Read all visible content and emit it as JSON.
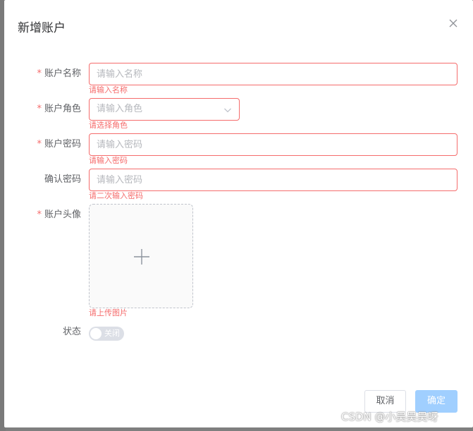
{
  "dialog": {
    "title": "新增账户"
  },
  "form": {
    "name": {
      "required": "*",
      "label": "账户名称",
      "placeholder": "请输入名称",
      "error": "请输入名称"
    },
    "role": {
      "required": "*",
      "label": "账户角色",
      "placeholder": "请输入角色",
      "error": "请选择角色"
    },
    "password": {
      "required": "*",
      "label": "账户密码",
      "placeholder": "请输入密码",
      "error": "请输入密码"
    },
    "confirm": {
      "label": "确认密码",
      "placeholder": "请输入密码",
      "error": "请二次输入密码"
    },
    "avatar": {
      "required": "*",
      "label": "账户头像",
      "error": "请上传图片"
    },
    "status": {
      "label": "状态",
      "switch_text": "关闭",
      "on": false
    }
  },
  "footer": {
    "cancel_label": "取消",
    "ok_label": "确定"
  },
  "watermark": "CSDN @小吴吴吴呀",
  "colors": {
    "error": "#f56c6c",
    "primary_disabled": "#a0cfff",
    "switch_off": "#dcdfe6"
  },
  "icons": {
    "close": "close-icon",
    "select": "chevron-down-icon",
    "upload": "plus-icon"
  }
}
